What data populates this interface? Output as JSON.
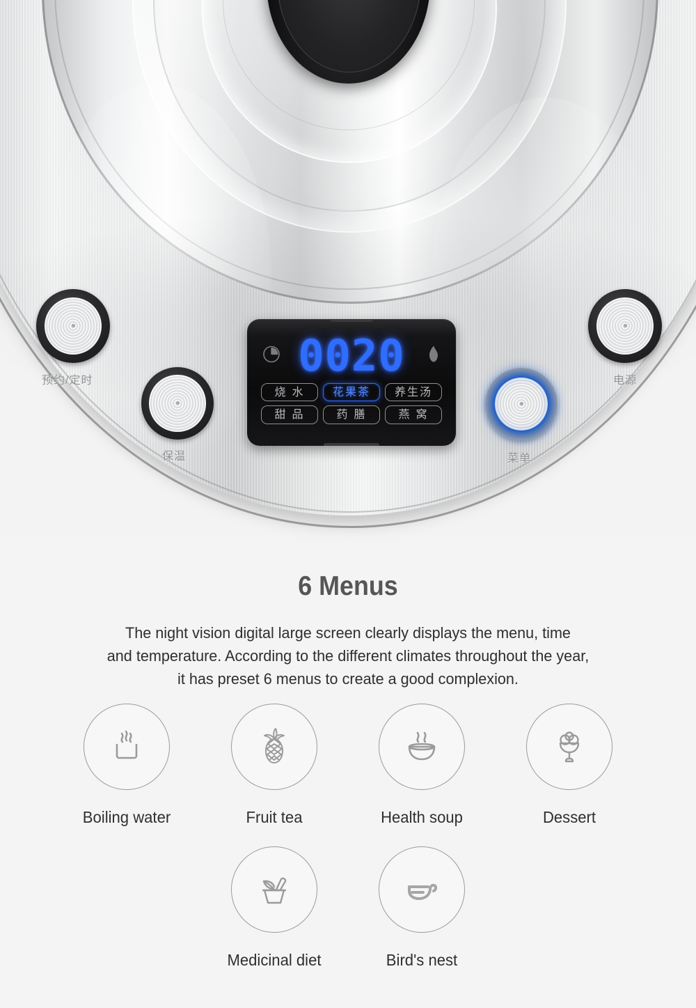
{
  "product": {
    "alt": "stainless steel health pot control panel",
    "knob_icon": "lid-knob-icon",
    "buttons": [
      {
        "id": "timer",
        "label": "预约/定时",
        "state": "off",
        "icon": "round-push-button-icon"
      },
      {
        "id": "keepwarm",
        "label": "保温",
        "state": "off",
        "icon": "round-push-button-icon"
      },
      {
        "id": "menu",
        "label": "菜单",
        "state": "lit",
        "icon": "round-push-button-icon"
      },
      {
        "id": "power",
        "label": "电源",
        "state": "off",
        "icon": "round-push-button-icon"
      }
    ]
  },
  "display": {
    "value": "0020",
    "left_icon": "clock-icon",
    "right_icon": "flame-icon",
    "glow_color": "#2f6dff",
    "inactive_color": "#b9bbbe",
    "menu_rows": [
      [
        {
          "label": "烧 水",
          "active": false
        },
        {
          "label": "花果茶",
          "active": true
        },
        {
          "label": "养生汤",
          "active": false
        }
      ],
      [
        {
          "label": "甜 品",
          "active": false
        },
        {
          "label": "药 膳",
          "active": false
        },
        {
          "label": "燕 窝",
          "active": false
        }
      ]
    ]
  },
  "copy": {
    "title": "6 Menus",
    "desc_lines": [
      "The night vision digital large screen clearly displays the menu, time",
      "and temperature. According to the different climates throughout the year,",
      "it has preset 6 menus to create a good complexion."
    ]
  },
  "features": [
    {
      "label": "Boiling water",
      "icon": "steaming-cup-icon"
    },
    {
      "label": "Fruit tea",
      "icon": "pineapple-icon"
    },
    {
      "label": "Health soup",
      "icon": "soup-bowl-icon"
    },
    {
      "label": "Dessert",
      "icon": "dessert-goblet-icon"
    },
    {
      "label": "Medicinal diet",
      "icon": "mortar-pestle-icon"
    },
    {
      "label": "Bird's nest",
      "icon": "birds-nest-icon"
    }
  ],
  "colors": {
    "background": "#f4f4f4",
    "title": "#565656",
    "body_text": "#2e2e2e",
    "icon_stroke": "#9b9b9b",
    "accent_blue": "#2f6dff"
  }
}
